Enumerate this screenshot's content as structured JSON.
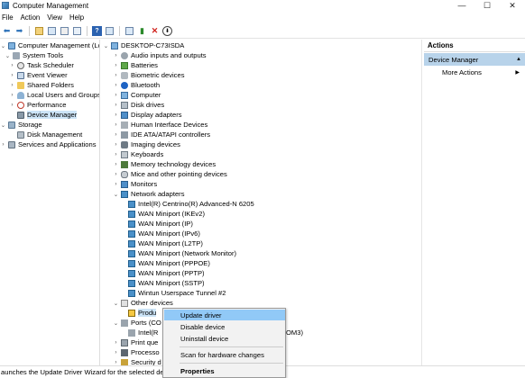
{
  "window": {
    "title": "Computer Management",
    "controls": {
      "minimize": "—",
      "maximize": "☐",
      "close": "✕"
    }
  },
  "menu": [
    "File",
    "Action",
    "View",
    "Help"
  ],
  "tree": [
    {
      "label": "Computer Management (Local",
      "chev": "⌄",
      "icon": "computer-icon"
    },
    {
      "label": "System Tools",
      "chev": "⌄",
      "icon": "tools-icon"
    },
    {
      "label": "Task Scheduler",
      "chev": "›",
      "icon": "clock-icon"
    },
    {
      "label": "Event Viewer",
      "chev": "›",
      "icon": "event-icon"
    },
    {
      "label": "Shared Folders",
      "chev": "›",
      "icon": "folder-icon"
    },
    {
      "label": "Local Users and Groups",
      "chev": "›",
      "icon": "users-icon"
    },
    {
      "label": "Performance",
      "chev": "›",
      "icon": "performance-icon"
    },
    {
      "label": "Device Manager",
      "chev": "",
      "icon": "device-manager-icon",
      "selected": true
    },
    {
      "label": "Storage",
      "chev": "⌄",
      "icon": "storage-icon"
    },
    {
      "label": "Disk Management",
      "chev": "",
      "icon": "disk-icon"
    },
    {
      "label": "Services and Applications",
      "chev": "›",
      "icon": "services-icon"
    }
  ],
  "devices": [
    {
      "label": "DESKTOP-C73ISDA",
      "chev": "⌄",
      "icon": "computer-icon"
    },
    {
      "label": "Audio inputs and outputs",
      "chev": "›",
      "icon": "audio-icon"
    },
    {
      "label": "Batteries",
      "chev": "›",
      "icon": "battery-icon"
    },
    {
      "label": "Biometric devices",
      "chev": "›",
      "icon": "biometric-icon"
    },
    {
      "label": "Bluetooth",
      "chev": "›",
      "icon": "bluetooth-icon"
    },
    {
      "label": "Computer",
      "chev": "›",
      "icon": "computer-icon"
    },
    {
      "label": "Disk drives",
      "chev": "›",
      "icon": "disk-icon"
    },
    {
      "label": "Display adapters",
      "chev": "›",
      "icon": "display-icon"
    },
    {
      "label": "Human Interface Devices",
      "chev": "›",
      "icon": "hid-icon"
    },
    {
      "label": "IDE ATA/ATAPI controllers",
      "chev": "›",
      "icon": "ide-icon"
    },
    {
      "label": "Imaging devices",
      "chev": "›",
      "icon": "camera-icon"
    },
    {
      "label": "Keyboards",
      "chev": "›",
      "icon": "keyboard-icon"
    },
    {
      "label": "Memory technology devices",
      "chev": "›",
      "icon": "memory-icon"
    },
    {
      "label": "Mice and other pointing devices",
      "chev": "›",
      "icon": "mouse-icon"
    },
    {
      "label": "Monitors",
      "chev": "›",
      "icon": "monitor-icon"
    },
    {
      "label": "Network adapters",
      "chev": "⌄",
      "icon": "network-icon"
    },
    {
      "label": "Intel(R) Centrino(R) Advanced-N 6205",
      "chev": "",
      "icon": "network-icon"
    },
    {
      "label": "WAN Miniport (IKEv2)",
      "chev": "",
      "icon": "network-icon"
    },
    {
      "label": "WAN Miniport (IP)",
      "chev": "",
      "icon": "network-icon"
    },
    {
      "label": "WAN Miniport (IPv6)",
      "chev": "",
      "icon": "network-icon"
    },
    {
      "label": "WAN Miniport (L2TP)",
      "chev": "",
      "icon": "network-icon"
    },
    {
      "label": "WAN Miniport (Network Monitor)",
      "chev": "",
      "icon": "network-icon"
    },
    {
      "label": "WAN Miniport (PPPOE)",
      "chev": "",
      "icon": "network-icon"
    },
    {
      "label": "WAN Miniport (PPTP)",
      "chev": "",
      "icon": "network-icon"
    },
    {
      "label": "WAN Miniport (SSTP)",
      "chev": "",
      "icon": "network-icon"
    },
    {
      "label": "Wintun Userspace Tunnel #2",
      "chev": "",
      "icon": "network-icon"
    },
    {
      "label": "Other devices",
      "chev": "⌄",
      "icon": "other-devices-icon"
    },
    {
      "label": "Produ",
      "chev": "",
      "icon": "warning-device-icon",
      "selected": true
    },
    {
      "label": "Ports (CO",
      "chev": "⌄",
      "icon": "ports-icon"
    },
    {
      "label": "Intel(R",
      "chev": "",
      "icon": "ports-icon",
      "suffix": "OM3)"
    },
    {
      "label": "Print que",
      "chev": "›",
      "icon": "printer-icon"
    },
    {
      "label": "Processo",
      "chev": "›",
      "icon": "processor-icon"
    },
    {
      "label": "Security d",
      "chev": "›",
      "icon": "security-icon"
    }
  ],
  "actions": {
    "header": "Actions",
    "section": "Device Manager",
    "more": "More Actions"
  },
  "context_menu": {
    "update_driver": "Update driver",
    "disable_device": "Disable device",
    "uninstall_device": "Uninstall device",
    "scan_changes": "Scan for hardware changes",
    "properties": "Properties"
  },
  "status": "aunches the Update Driver Wizard for the selected device.",
  "colors": {
    "selection": "#cce4f7",
    "menu_hover": "#91c9f7",
    "actions_section": "#b8d3ea",
    "network_icon": "#4a90c8"
  }
}
